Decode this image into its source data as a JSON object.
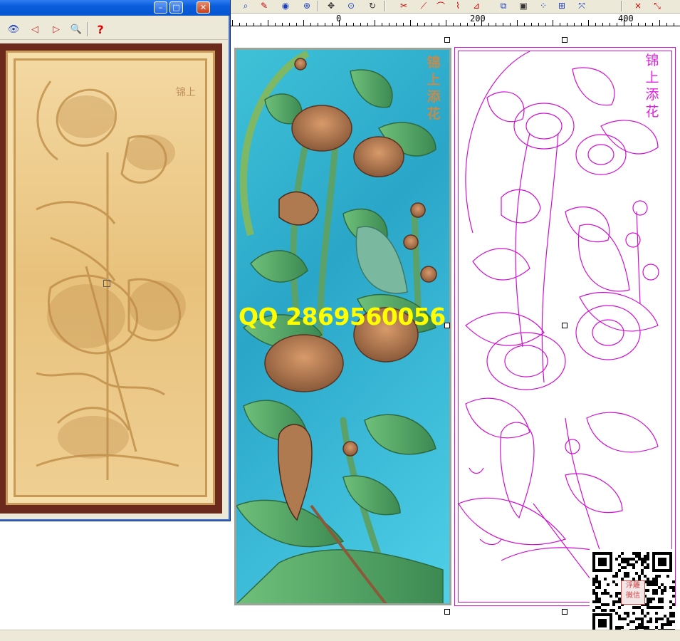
{
  "toolbar": {
    "icons": [
      "search-icon",
      "edit-icon",
      "eye-icon",
      "zoom-window-icon",
      "pan-icon",
      "zoom-icon",
      "rotate-icon",
      "cut-icon",
      "line-icon",
      "arc-icon",
      "curve-icon",
      "polyline-icon",
      "layer-icon",
      "rect-icon",
      "node-icon",
      "align-icon",
      "transform-icon",
      "delete-icon",
      "mirror-icon"
    ],
    "colors": {
      "accent_red": "#cc0000",
      "accent_blue": "#1a3fbf"
    }
  },
  "ruler": {
    "labels": [
      "0",
      "200",
      "400"
    ]
  },
  "viewer": {
    "window_buttons": {
      "minimize": "–",
      "maximize": "□",
      "close": "✕"
    },
    "tools": {
      "eye": "👁",
      "prev": "◁",
      "next": "▷",
      "zoom": "🔍",
      "help": "?"
    }
  },
  "relief": {
    "title_chars": [
      "锦",
      "上",
      "添",
      "花"
    ]
  },
  "watermark": {
    "text": "QQ 2869560056"
  },
  "vector": {
    "title_chars": [
      "锦",
      "上",
      "添",
      "花"
    ],
    "stroke_color": "#d010d0"
  },
  "qr": {
    "stamp": "浮雕 微信"
  }
}
